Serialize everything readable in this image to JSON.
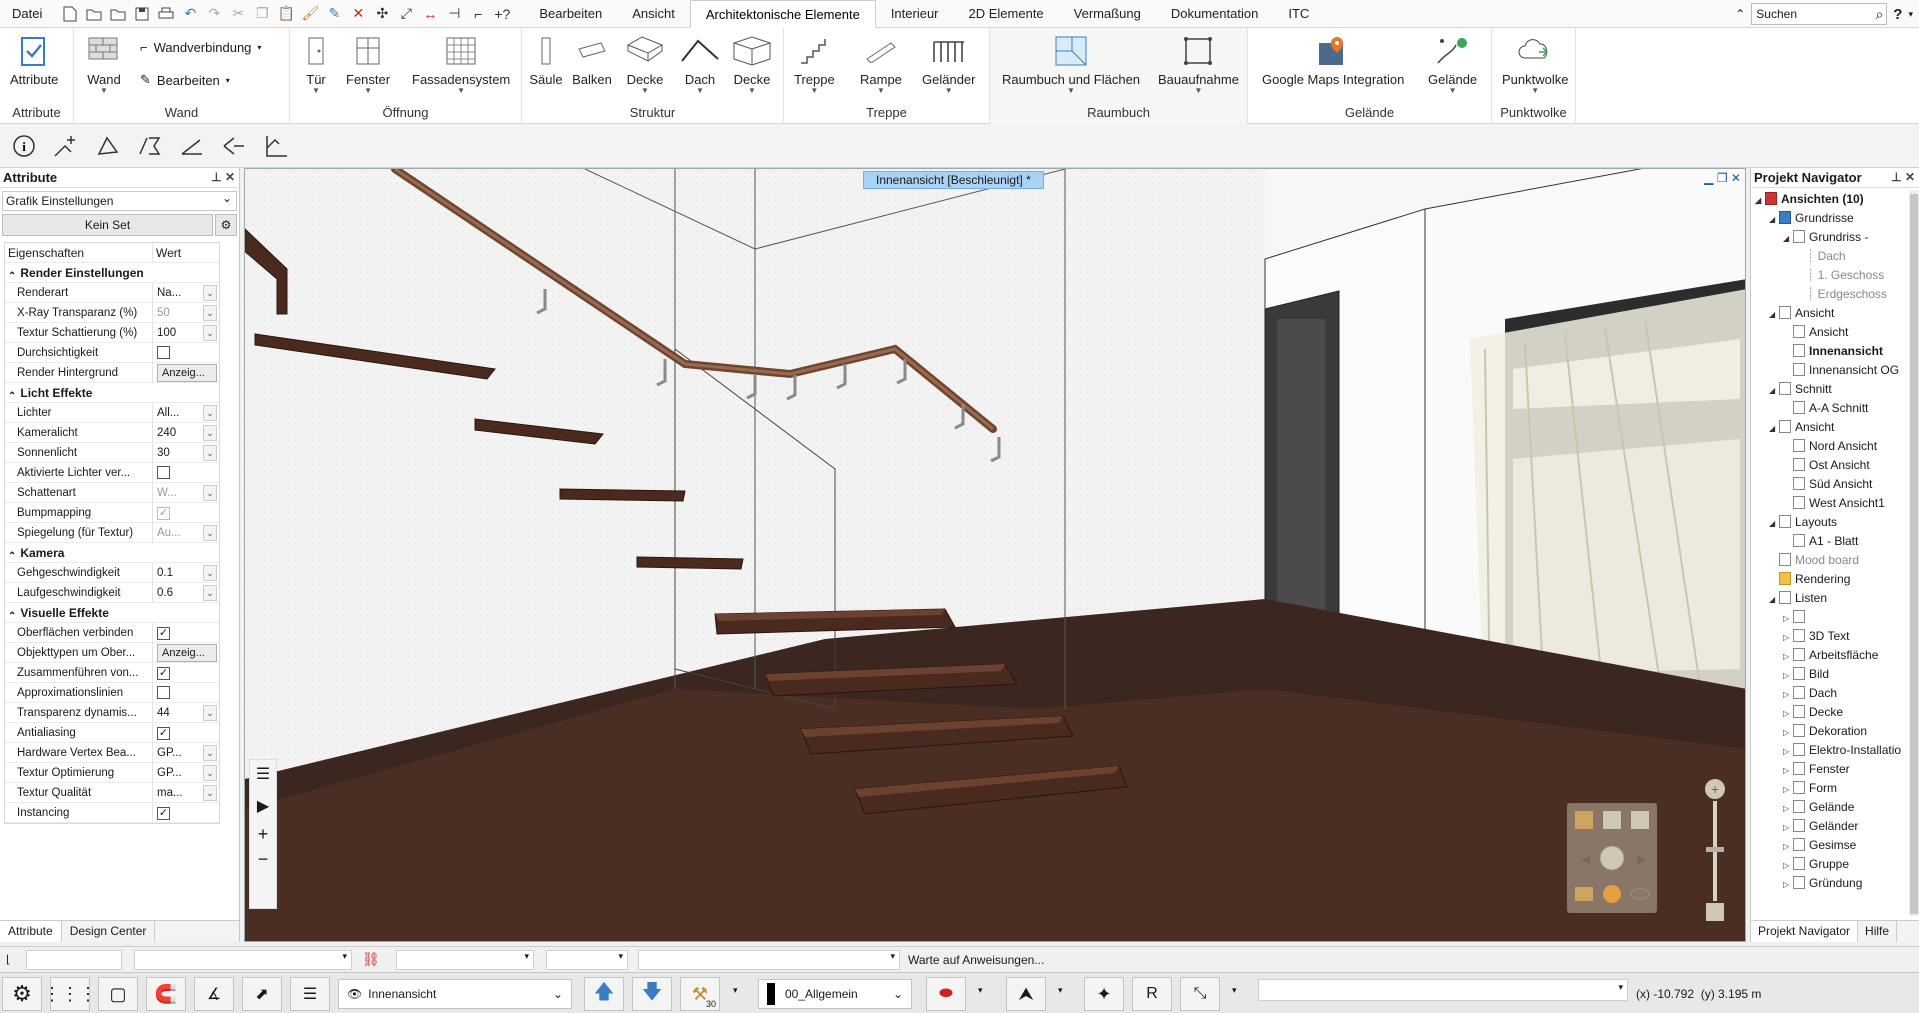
{
  "menubar": {
    "file": "Datei",
    "tabs": [
      "Bearbeiten",
      "Ansicht",
      "Architektonische Elemente",
      "Interieur",
      "2D Elemente",
      "Vermaßung",
      "Dokumentation",
      "ITC"
    ],
    "active_tab": "Architektonische Elemente",
    "search_placeholder": "Suchen",
    "help": "?"
  },
  "ribbon": {
    "attribute": {
      "button": "Attribute",
      "title": "Attribute"
    },
    "wand": {
      "button": "Wand",
      "wandverbindung": "Wandverbindung",
      "bearbeiten": "Bearbeiten",
      "title": "Wand"
    },
    "oeffnung": {
      "tuer": "Tür",
      "fenster": "Fenster",
      "fassadensystem": "Fassadensystem",
      "title": "Öffnung"
    },
    "struktur": {
      "saeule": "Säule",
      "balken": "Balken",
      "decke": "Decke",
      "dach": "Dach",
      "decke2": "Decke",
      "title": "Struktur"
    },
    "treppe": {
      "treppe": "Treppe",
      "rampe": "Rampe",
      "gelaender": "Geländer",
      "title": "Treppe"
    },
    "raumbuch": {
      "raumbuch": "Raumbuch und Flächen",
      "bauaufnahme": "Bauaufnahme",
      "title": "Raumbuch"
    },
    "gelaende": {
      "google": "Google Maps Integration",
      "gelaende": "Gelände",
      "title": "Gelände"
    },
    "punktwolke": {
      "punktwolke": "Punktwolke",
      "title": "Punktwolke"
    }
  },
  "left_panel": {
    "title": "Attribute",
    "combo": "Grafik Einstellungen",
    "set_button": "Kein Set",
    "col_property": "Eigenschaften",
    "col_value": "Wert",
    "rows": [
      {
        "type": "section",
        "name": "Render Einstellungen"
      },
      {
        "type": "dd",
        "name": "Renderart",
        "value": "Na..."
      },
      {
        "type": "dd",
        "name": "X-Ray Transparanz (%)",
        "value": "50",
        "dim": true
      },
      {
        "type": "dd",
        "name": "Textur Schattierung (%)",
        "value": "100"
      },
      {
        "type": "chk",
        "name": "Durchsichtigkeit",
        "checked": false
      },
      {
        "type": "btn",
        "name": "Render Hintergrund",
        "value": "Anzeig..."
      },
      {
        "type": "section",
        "name": "Licht Effekte"
      },
      {
        "type": "dd",
        "name": "Lichter",
        "value": "All..."
      },
      {
        "type": "dd",
        "name": "Kameralicht",
        "value": "240"
      },
      {
        "type": "dd",
        "name": "Sonnenlicht",
        "value": "30"
      },
      {
        "type": "chk",
        "name": "Aktivierte Lichter ver...",
        "checked": false
      },
      {
        "type": "dd",
        "name": "Schattenart",
        "value": "W...",
        "dim": true
      },
      {
        "type": "chk",
        "name": "Bumpmapping",
        "checked": true,
        "dim": true
      },
      {
        "type": "dd",
        "name": "Spiegelung (für Textur)",
        "value": "Au...",
        "dim": true
      },
      {
        "type": "section",
        "name": "Kamera"
      },
      {
        "type": "dd",
        "name": "Gehgeschwindigkeit",
        "value": "0.1"
      },
      {
        "type": "dd",
        "name": "Laufgeschwindigkeit",
        "value": "0.6"
      },
      {
        "type": "section",
        "name": "Visuelle Effekte"
      },
      {
        "type": "chk",
        "name": "Oberflächen verbinden",
        "checked": true
      },
      {
        "type": "btn",
        "name": "Objekttypen um Ober...",
        "value": "Anzeig..."
      },
      {
        "type": "chk",
        "name": "Zusammenführen von...",
        "checked": true
      },
      {
        "type": "chk",
        "name": "Approximationslinien",
        "checked": false
      },
      {
        "type": "dd",
        "name": "Transparenz dynamis...",
        "value": "44"
      },
      {
        "type": "chk",
        "name": "Antialiasing",
        "checked": true
      },
      {
        "type": "dd",
        "name": "Hardware Vertex Bea...",
        "value": "GP..."
      },
      {
        "type": "dd",
        "name": "Textur Optimierung",
        "value": "GP..."
      },
      {
        "type": "dd",
        "name": "Textur Qualität",
        "value": "ma..."
      },
      {
        "type": "chk",
        "name": "Instancing",
        "checked": true
      }
    ],
    "tab_attribute": "Attribute",
    "tab_design": "Design Center"
  },
  "viewport": {
    "title": "Innenansicht [Beschleunigt] *"
  },
  "right_panel": {
    "title": "Projekt Navigator",
    "tree": [
      {
        "level": 0,
        "label": "Ansichten (10)",
        "toggle": "▴",
        "bold": true,
        "icon": "red"
      },
      {
        "level": 1,
        "label": "Grundrisse",
        "toggle": "▴",
        "icon": "blue"
      },
      {
        "level": 2,
        "label": "Grundriss -",
        "toggle": "▴",
        "icon": "doc"
      },
      {
        "level": 3,
        "label": "Dach",
        "gray": true
      },
      {
        "level": 3,
        "label": "1. Geschoss",
        "gray": true
      },
      {
        "level": 3,
        "label": "Erdgeschoss",
        "gray": true
      },
      {
        "level": 1,
        "label": "Ansicht",
        "toggle": "▴",
        "icon": "doc"
      },
      {
        "level": 2,
        "label": "Ansicht",
        "icon": "doc"
      },
      {
        "level": 2,
        "label": "Innenansicht",
        "icon": "doc",
        "bold": true
      },
      {
        "level": 2,
        "label": "Innenansicht OG",
        "icon": "doc"
      },
      {
        "level": 1,
        "label": "Schnitt",
        "toggle": "▴",
        "icon": "doc"
      },
      {
        "level": 2,
        "label": "A-A Schnitt",
        "icon": "doc"
      },
      {
        "level": 1,
        "label": "Ansicht",
        "toggle": "▴",
        "icon": "doc"
      },
      {
        "level": 2,
        "label": "Nord Ansicht",
        "icon": "doc"
      },
      {
        "level": 2,
        "label": "Ost Ansicht",
        "icon": "doc"
      },
      {
        "level": 2,
        "label": "Süd Ansicht",
        "icon": "doc"
      },
      {
        "level": 2,
        "label": "West Ansicht1",
        "icon": "doc"
      },
      {
        "level": 1,
        "label": "Layouts",
        "toggle": "▴",
        "icon": "doc"
      },
      {
        "level": 2,
        "label": "A1 - Blatt",
        "icon": "doc"
      },
      {
        "level": 1,
        "label": "Mood board",
        "icon": "doc",
        "gray": true
      },
      {
        "level": 1,
        "label": "Rendering",
        "icon": "folder"
      },
      {
        "level": 1,
        "label": "Listen",
        "toggle": "▴",
        "icon": "doc"
      },
      {
        "level": 2,
        "label": "",
        "toggle": "▸",
        "icon": "doc"
      },
      {
        "level": 2,
        "label": "3D Text",
        "toggle": "▸",
        "icon": "doc"
      },
      {
        "level": 2,
        "label": "Arbeitsfläche",
        "toggle": "▸",
        "icon": "doc"
      },
      {
        "level": 2,
        "label": "Bild",
        "toggle": "▸",
        "icon": "doc"
      },
      {
        "level": 2,
        "label": "Dach",
        "toggle": "▸",
        "icon": "doc"
      },
      {
        "level": 2,
        "label": "Decke",
        "toggle": "▸",
        "icon": "doc"
      },
      {
        "level": 2,
        "label": "Dekoration",
        "toggle": "▸",
        "icon": "doc"
      },
      {
        "level": 2,
        "label": "Elektro-Installatio",
        "toggle": "▸",
        "icon": "doc"
      },
      {
        "level": 2,
        "label": "Fenster",
        "toggle": "▸",
        "icon": "doc"
      },
      {
        "level": 2,
        "label": "Form",
        "toggle": "▸",
        "icon": "doc"
      },
      {
        "level": 2,
        "label": "Gelände",
        "toggle": "▸",
        "icon": "doc"
      },
      {
        "level": 2,
        "label": "Geländer",
        "toggle": "▸",
        "icon": "doc"
      },
      {
        "level": 2,
        "label": "Gesimse",
        "toggle": "▸",
        "icon": "doc"
      },
      {
        "level": 2,
        "label": "Gruppe",
        "toggle": "▸",
        "icon": "doc"
      },
      {
        "level": 2,
        "label": "Gründung",
        "toggle": "▸",
        "icon": "doc"
      }
    ],
    "tab_navigator": "Projekt Navigator",
    "tab_help": "Hilfe"
  },
  "status": {
    "message": "Warte auf Anweisungen...",
    "view_combo": "Innenansicht",
    "layer_combo": "00_Allgemein",
    "coords": "(x) -10.792  (y) 3.195 m",
    "hammer_badge": "30"
  }
}
